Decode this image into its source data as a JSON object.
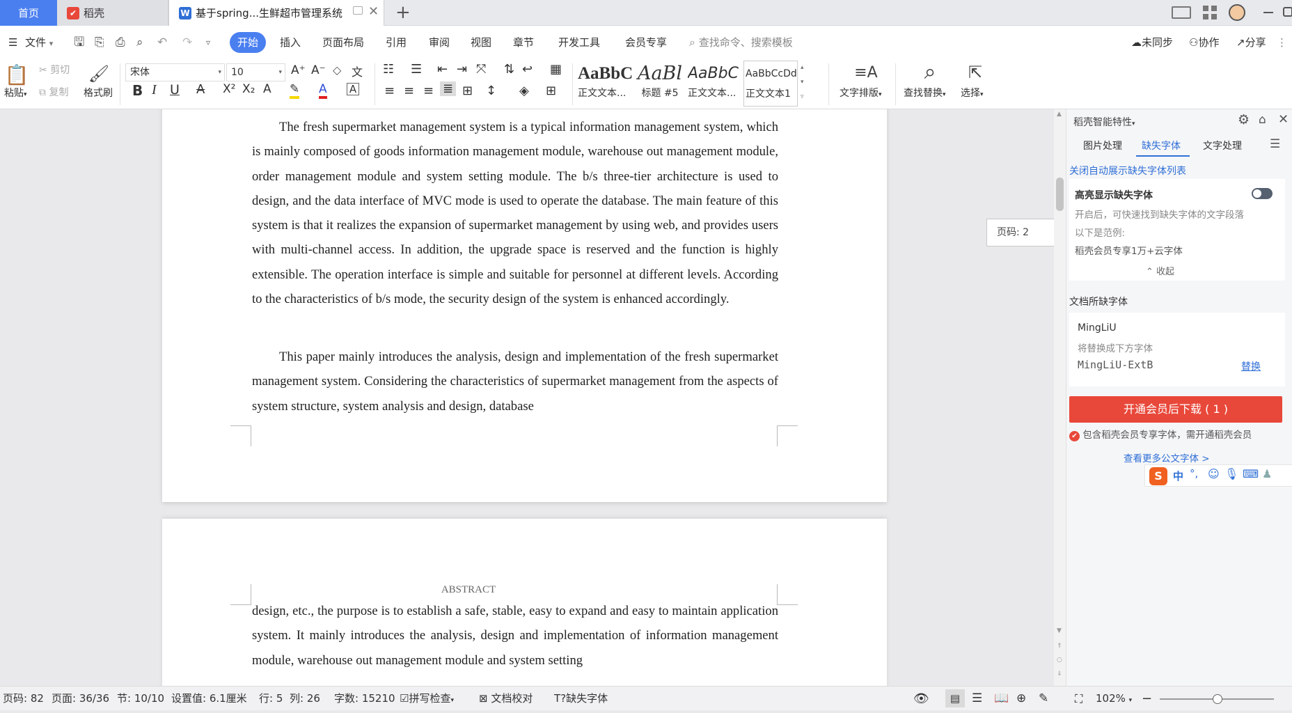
{
  "tabs": {
    "home": "首页",
    "daoke": "稻壳",
    "document": "基于spring...生鲜超市管理系统"
  },
  "menu": {
    "file": "文件",
    "items": [
      "开始",
      "插入",
      "页面布局",
      "引用",
      "审阅",
      "视图",
      "章节",
      "开发工具",
      "会员专享"
    ],
    "search_placeholder": "查找命令、搜索模板",
    "sync": "未同步",
    "collab": "协作",
    "share": "分享"
  },
  "toolbar": {
    "paste": "粘贴",
    "cut": "剪切",
    "copy": "复制",
    "format_painter": "格式刷",
    "font_name": "宋体",
    "font_size": "10",
    "styles": [
      {
        "preview": "AaBbC",
        "label": "正文文本..."
      },
      {
        "preview": "AaBl",
        "label": "标题 #5"
      },
      {
        "preview": "AaBbC",
        "label": "正文文本..."
      },
      {
        "preview": "AaBbCcDd",
        "label": "正文文本1"
      }
    ],
    "text_layout": "文字排版",
    "find_replace": "查找替换",
    "select": "选择"
  },
  "document": {
    "para1": "The fresh supermarket management system is a typical information management system, which is mainly composed of goods information management module, warehouse out management module, order management module and system setting module. The b/s three-tier architecture is used to design, and the data interface of MVC mode is used to operate the database. The main feature of this system is that it realizes the expansion of supermarket management by using web, and provides users with multi-channel access. In addition, the upgrade space is reserved and the function is highly extensible. The operation interface is simple and suitable for personnel at different levels. According to the characteristics of b/s mode, the security design of the system is enhanced accordingly.",
    "para2": "This paper mainly introduces the analysis, design and implementation of the fresh supermarket management system. Considering the characteristics of supermarket management from the aspects of system structure, system analysis and design, database",
    "page2_header": "ABSTRACT",
    "page2_text": "design, etc., the purpose is to establish a safe, stable, easy to expand and easy to maintain application system. It mainly introduces the analysis, design and implementation of information management module, warehouse out management module and system setting",
    "page_tooltip": "页码: 2"
  },
  "panel": {
    "title": "稻壳智能特性",
    "tabs": [
      "图片处理",
      "缺失字体",
      "文字处理"
    ],
    "active_tab": 1,
    "close_auto_link": "关闭自动展示缺失字体列表",
    "highlight_title": "高亮显示缺失字体",
    "highlight_desc": "开启后，可快速找到缺失字体的文字段落",
    "example_label": "以下是范例:",
    "example_text": "稻壳会员专享1万+云字体",
    "collapse": "收起",
    "missing_fonts_title": "文档所缺字体",
    "missing_font": "MingLiU",
    "replace_desc": "将替换成下方字体",
    "replace_font": "MingLiU-ExtB",
    "replace_link": "替换",
    "download_button": "开通会员后下载 ( 1 )",
    "member_note": "包含稻壳会员专享字体，需开通稻壳会员",
    "more_fonts": "查看更多公文字体 >",
    "accent": "#e8483a",
    "link_color": "#2f6fd6"
  },
  "ime": {
    "lang": "中"
  },
  "statusbar": {
    "page_no": "页码: 82",
    "page_count": "页面: 36/36",
    "section": "节: 10/10",
    "setting": "设置值: 6.1厘米",
    "row": "行: 5",
    "col": "列: 26",
    "word_count": "字数: 15210",
    "spell_check": "拼写检查",
    "proofread": "文档校对",
    "missing_font": "缺失字体",
    "zoom": "102%"
  }
}
